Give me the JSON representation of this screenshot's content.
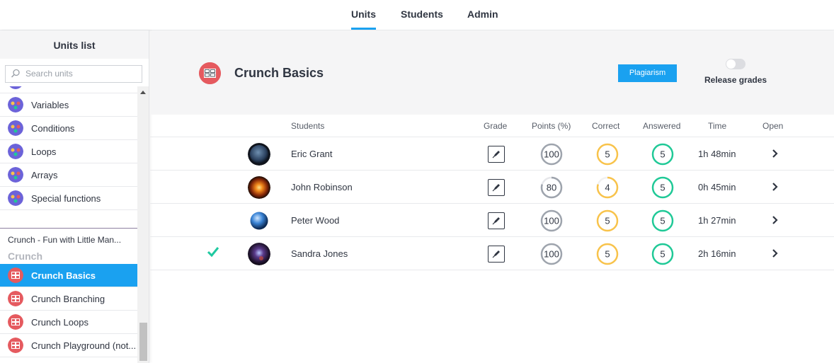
{
  "nav": {
    "tabs": [
      "Units",
      "Students",
      "Admin"
    ],
    "active": "Units"
  },
  "sidebar": {
    "title": "Units list",
    "search_placeholder": "Search units",
    "items_top": [
      "Variables",
      "Conditions",
      "Loops",
      "Arrays",
      "Special functions"
    ],
    "course": "Crunch - Fun with Little Man...",
    "section": "Crunch",
    "items_bottom": [
      "Crunch Basics",
      "Crunch Branching",
      "Crunch Loops",
      "Crunch Playground (not..."
    ],
    "active_item": "Crunch Basics"
  },
  "header": {
    "title": "Crunch Basics",
    "plagiarism_label": "Plagiarism",
    "release_label": "Release grades",
    "release_on": false
  },
  "table": {
    "columns": [
      "Students",
      "Grade",
      "Points (%)",
      "Correct",
      "Answered",
      "Time",
      "Open"
    ],
    "rows": [
      {
        "name": "Eric Grant",
        "points": 100,
        "correct": 5,
        "answered": 5,
        "time": "1h 48min",
        "checked": false
      },
      {
        "name": "John Robinson",
        "points": 80,
        "correct": 4,
        "answered": 5,
        "time": "0h 45min",
        "checked": false
      },
      {
        "name": "Peter Wood",
        "points": 100,
        "correct": 5,
        "answered": 5,
        "time": "1h 27min",
        "checked": false
      },
      {
        "name": "Sandra Jones",
        "points": 100,
        "correct": 5,
        "answered": 5,
        "time": "2h 16min",
        "checked": true
      }
    ]
  },
  "colors": {
    "accent": "#1aa1f0",
    "points": "#9ea4ad",
    "correct": "#f8c34b",
    "answered": "#20c997",
    "check": "#1fc9a0",
    "unit_icon": "#e55a5f",
    "var_icon": "#6c63d9"
  },
  "icons": {
    "search": "search-icon",
    "grade": "grade-pen-icon",
    "open": "chevron-right-icon",
    "check": "checkmark-icon"
  }
}
